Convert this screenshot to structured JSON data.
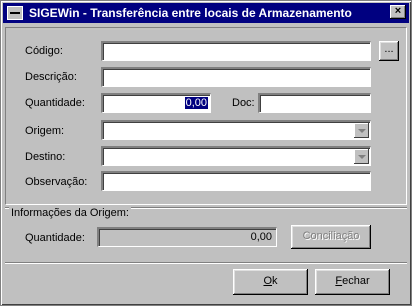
{
  "window": {
    "title": "SIGEWin - Transferência entre locais de Armazenamento",
    "close_glyph": "×"
  },
  "form": {
    "codigo_label": "Código:",
    "codigo_value": "",
    "browse_label": "...",
    "descricao_label": "Descrição:",
    "descricao_value": "",
    "quantidade_label": "Quantidade:",
    "quantidade_value": "0,00",
    "doc_label": "Doc:",
    "doc_value": "",
    "origem_label": "Origem:",
    "origem_value": "",
    "destino_label": "Destino:",
    "destino_value": "",
    "observacao_label": "Observação:",
    "observacao_value": ""
  },
  "origin_info": {
    "group_title": "Informações da Origem:",
    "quantidade_label": "Quantidade:",
    "quantidade_value": "0,00",
    "conciliacao_label": "Conciliação"
  },
  "footer": {
    "ok_underline": "O",
    "ok_rest": "k",
    "fechar_underline": "F",
    "fechar_rest": "echar"
  }
}
